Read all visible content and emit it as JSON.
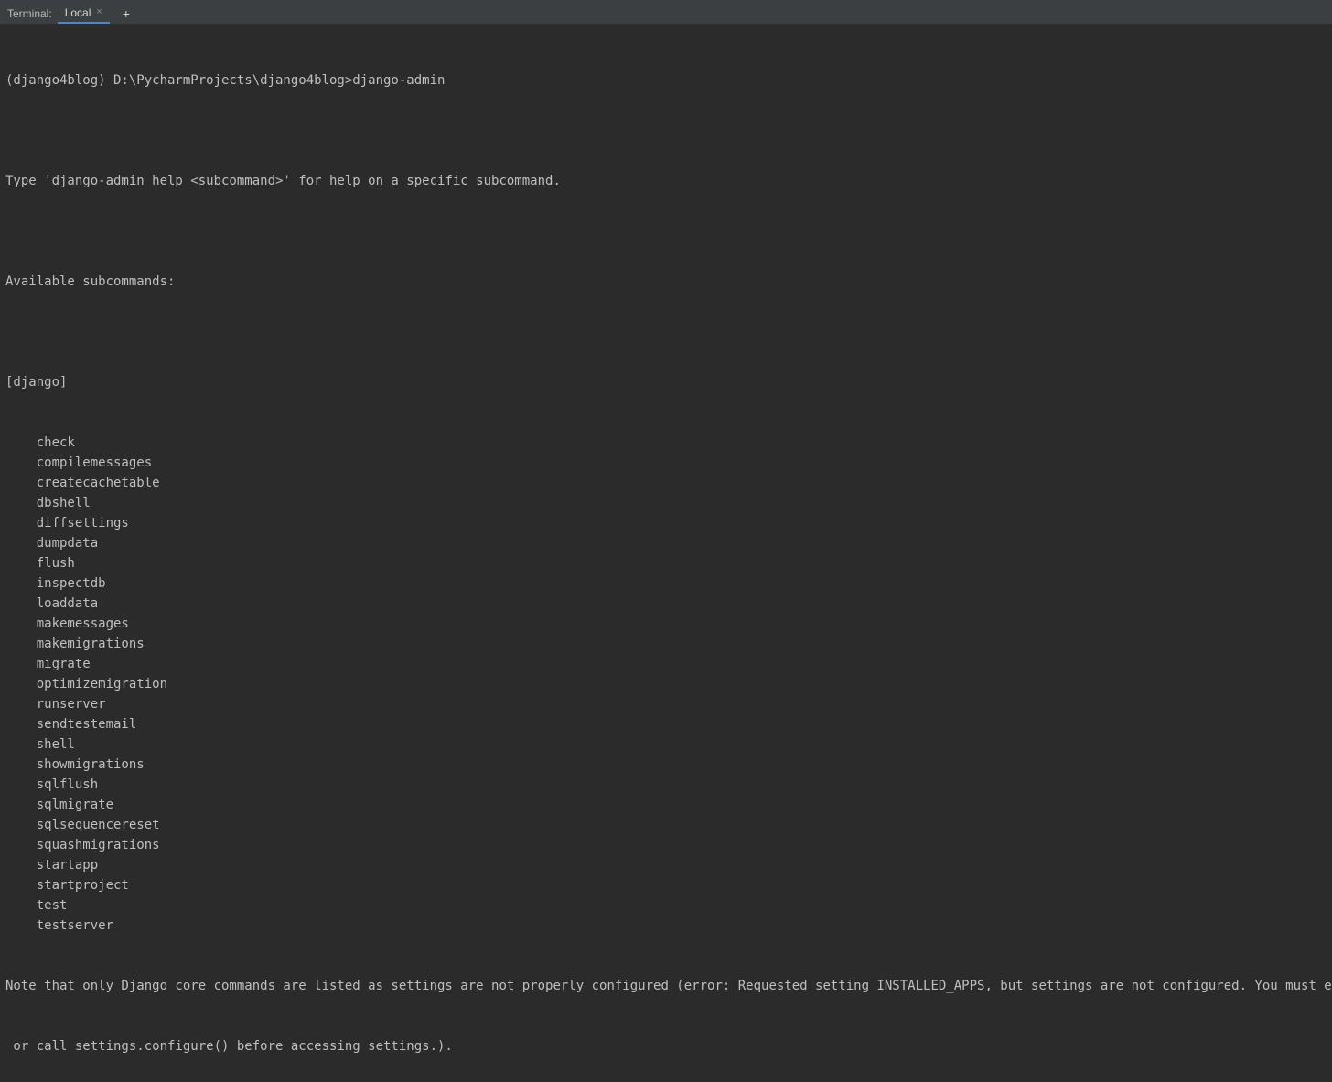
{
  "tabbar": {
    "panel_label": "Terminal:",
    "active_tab": "Local",
    "close_glyph": "×",
    "add_glyph": "+"
  },
  "terminal": {
    "prompt_line": "(django4blog) D:\\PycharmProjects\\django4blog>django-admin",
    "blank": "",
    "help_line": "Type 'django-admin help <subcommand>' for help on a specific subcommand.",
    "avail_line": "Available subcommands:",
    "section_header": "[django]",
    "commands": [
      "check",
      "compilemessages",
      "createcachetable",
      "dbshell",
      "diffsettings",
      "dumpdata",
      "flush",
      "inspectdb",
      "loaddata",
      "makemessages",
      "makemigrations",
      "migrate",
      "optimizemigration",
      "runserver",
      "sendtestemail",
      "shell",
      "showmigrations",
      "sqlflush",
      "sqlmigrate",
      "sqlsequencereset",
      "squashmigrations",
      "startapp",
      "startproject",
      "test",
      "testserver"
    ],
    "note_line1": "Note that only Django core commands are listed as settings are not properly configured (error: Requested setting INSTALLED_APPS, but settings are not configured. You must either def",
    "note_line2": " or call settings.configure() before accessing settings.)."
  }
}
